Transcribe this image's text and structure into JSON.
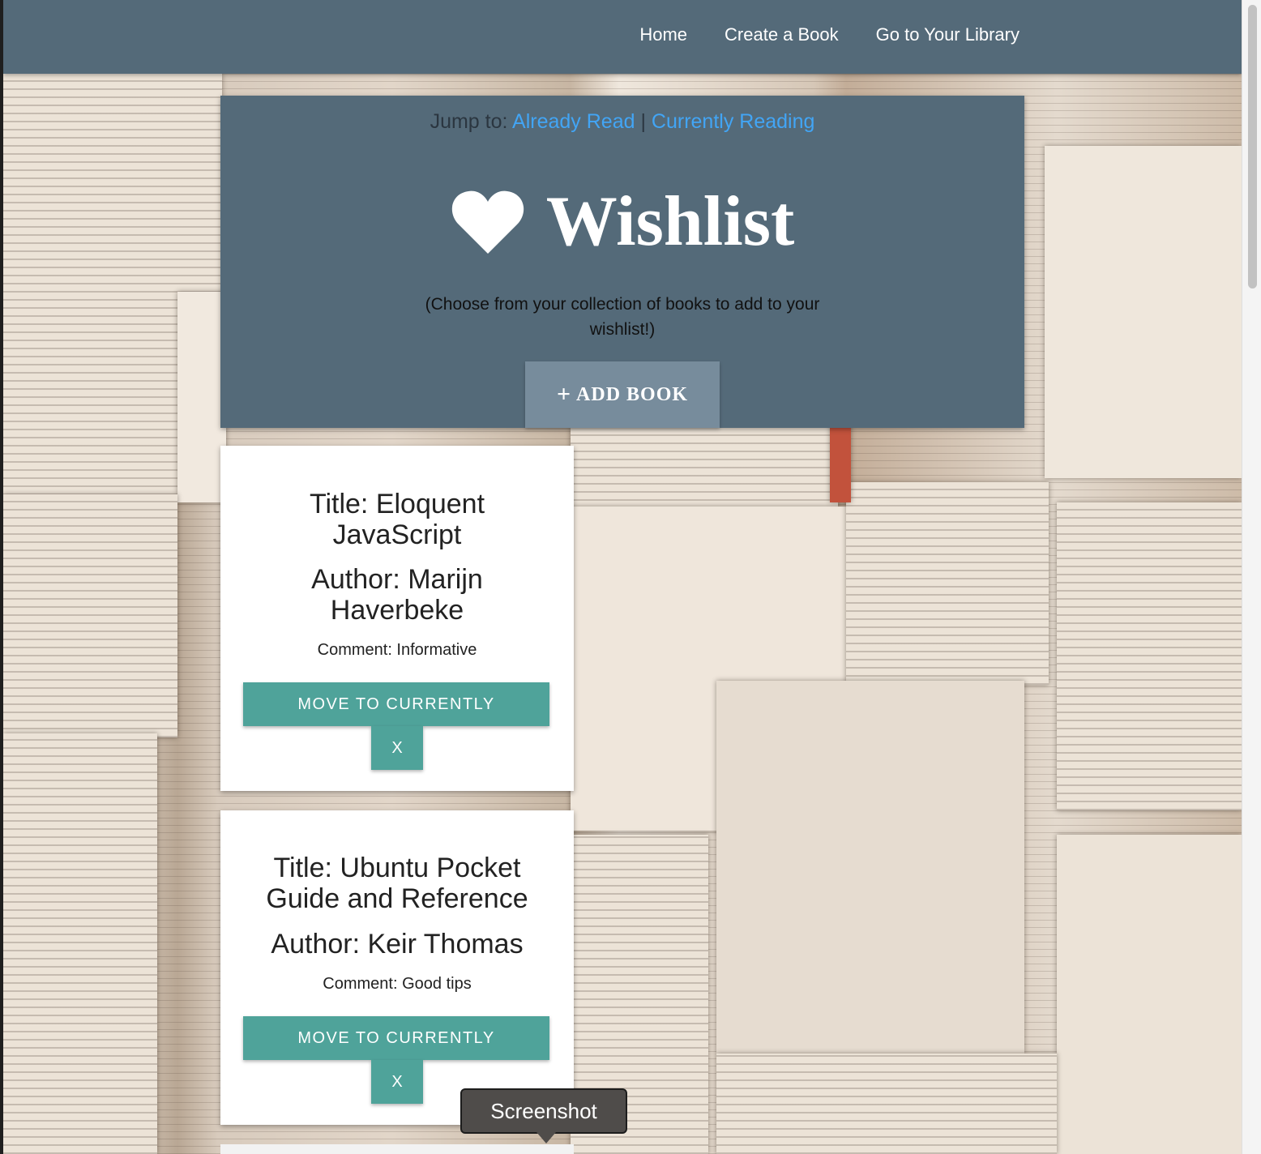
{
  "navbar": {
    "links": [
      "Home",
      "Create a Book",
      "Go to Your Library"
    ]
  },
  "header": {
    "jump_label": "Jump to:",
    "jump_links": [
      "Already Read",
      "Currently Reading"
    ],
    "separator": "|",
    "title": "Wishlist",
    "title_icon": "heart-icon",
    "subtitle": "(Choose from your collection of books to add to your wishlist!)",
    "add_button": "ADD BOOK",
    "add_icon": "plus-icon"
  },
  "books": [
    {
      "title": "Title: Eloquent JavaScript",
      "author": "Author: Marijn Haverbeke",
      "comment": "Comment: Informative",
      "move_label": "MOVE TO CURRENTLY",
      "remove_label": "X"
    },
    {
      "title": "Title: Ubuntu Pocket Guide and Reference",
      "author": "Author: Keir Thomas",
      "comment": "Comment: Good tips",
      "move_label": "MOVE TO CURRENTLY",
      "remove_label": "X"
    }
  ],
  "tooltip": "Screenshot",
  "colors": {
    "navbar": "#546a79",
    "accent_button": "#4fa39a",
    "link": "#42a5f5",
    "add_button": "#778c9c"
  }
}
